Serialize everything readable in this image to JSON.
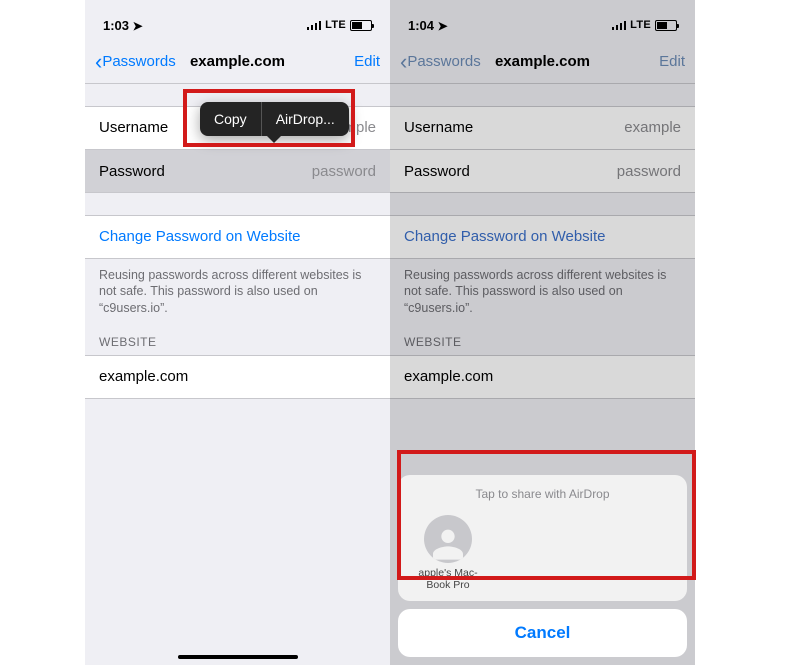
{
  "left": {
    "status": {
      "time": "1:03",
      "net": "LTE"
    },
    "nav": {
      "back": "Passwords",
      "title": "example.com",
      "edit": "Edit"
    },
    "rows": {
      "username_label": "Username",
      "username_value": "example",
      "password_label": "Password",
      "password_value": "password",
      "change_link": "Change Password on Website",
      "footer": "Reusing passwords across different websites is not safe. This password is also used on “c9users.io”.",
      "section": "WEBSITE",
      "website": "example.com"
    },
    "menu": {
      "copy": "Copy",
      "airdrop": "AirDrop..."
    }
  },
  "right": {
    "status": {
      "time": "1:04",
      "net": "LTE"
    },
    "nav": {
      "back": "Passwords",
      "title": "example.com",
      "edit": "Edit"
    },
    "rows": {
      "username_label": "Username",
      "username_value": "example",
      "password_label": "Password",
      "password_value": "password",
      "change_link": "Change Password on Website",
      "footer": "Reusing passwords across different websites is not safe. This password is also used on “c9users.io”.",
      "section": "WEBSITE",
      "website": "example.com"
    },
    "sheet": {
      "title": "Tap to share with AirDrop",
      "target": "apple's Mac-\nBook Pro",
      "cancel": "Cancel"
    }
  }
}
